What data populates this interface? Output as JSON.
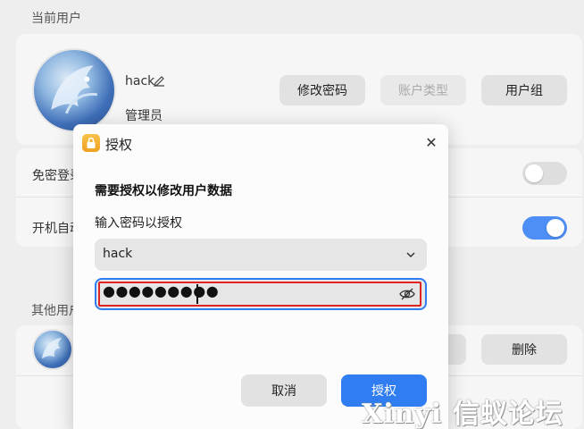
{
  "current_user": {
    "section_title": "当前用户",
    "username": "hack",
    "role": "管理员",
    "buttons": {
      "change_password": "修改密码",
      "account_type": "账户类型",
      "user_group": "用户组"
    }
  },
  "settings": {
    "password_free_login": {
      "label": "免密登录",
      "enabled": false
    },
    "auto_login": {
      "label": "开机自动",
      "enabled": true
    }
  },
  "other_users": {
    "section_title": "其他用户",
    "delete_label": "删除"
  },
  "auth_dialog": {
    "title": "授权",
    "heading": "需要授权以修改用户数据",
    "prompt": "输入密码以授权",
    "selected_user": "hack",
    "password_mask": "●●●●●●●●●",
    "cancel_label": "取消",
    "confirm_label": "授权"
  },
  "colors": {
    "accent": "#2f7df0",
    "annotation": "#e02424"
  },
  "watermark": "Xinyi 信蚁论坛"
}
